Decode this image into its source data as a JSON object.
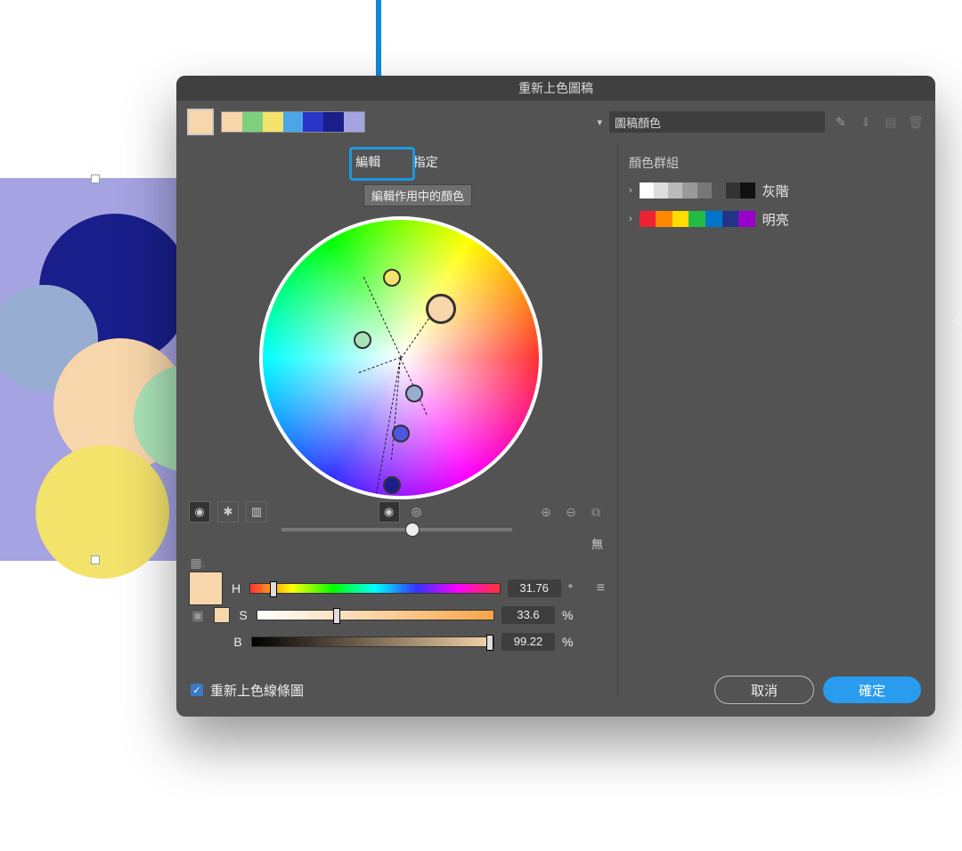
{
  "dialog": {
    "title": "重新上色圖稿",
    "preset_name": "圖稿顏色",
    "tabs": {
      "edit": "編輯",
      "assign": "指定"
    },
    "tooltip": "編輯作用中的顏色",
    "no_label": "無",
    "recolor_checkbox": "重新上色線條圖",
    "cancel": "取消",
    "ok": "確定"
  },
  "harmony_colors": [
    "#f8d6ab",
    "#7ed07e",
    "#f3e36b",
    "#4aa6e6",
    "#2b34c8",
    "#191e8a",
    "#a5a3e1"
  ],
  "hsb": {
    "h": {
      "label": "H",
      "value": "31.76",
      "unit": "°"
    },
    "s": {
      "label": "S",
      "value": "33.6",
      "unit": "%"
    },
    "b": {
      "label": "B",
      "value": "99.22",
      "unit": "%"
    }
  },
  "groups": {
    "title": "顏色群組",
    "items": [
      {
        "label": "灰階",
        "colors": [
          "#fff",
          "#ddd",
          "#bbb",
          "#999",
          "#777",
          "#555",
          "#333",
          "#111"
        ]
      },
      {
        "label": "明亮",
        "colors": [
          "#e23",
          "#f80",
          "#fd0",
          "#2b4",
          "#07c",
          "#238",
          "#90c"
        ]
      }
    ]
  }
}
